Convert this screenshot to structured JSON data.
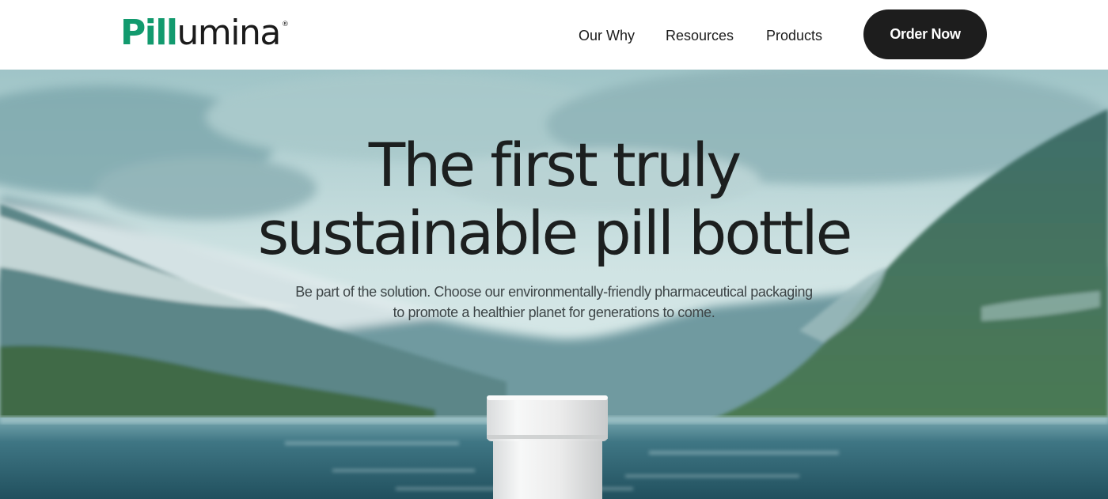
{
  "brand": {
    "logo_part1": "Pill",
    "logo_part2": "umina",
    "logo_mark": "®",
    "accent_color": "#129a6e",
    "dark_color": "#1b1b1b"
  },
  "nav": {
    "items": [
      {
        "label": "Our Why"
      },
      {
        "label": "Resources"
      },
      {
        "label": "Products"
      }
    ],
    "cta_label": "Order Now"
  },
  "hero": {
    "title_line1": "The first truly",
    "title_line2": "sustainable pill bottle",
    "subtitle_line1": "Be part of the solution. Choose our environmentally-friendly pharmaceutical packaging",
    "subtitle_line2": "to promote a healthier planet for generations to come."
  },
  "icons": [
    "pill-bottle-icon"
  ]
}
